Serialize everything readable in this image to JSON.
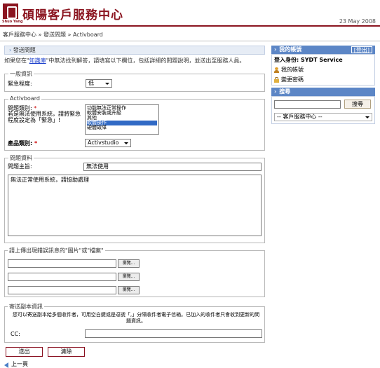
{
  "header": {
    "site_title": "碩陽客戶服務中心",
    "logo_text": "Shuo Yang",
    "date": "23 May 2008"
  },
  "breadcrumb": "客戶服務中心 » 發送問題 » Activboard",
  "form": {
    "section_title": "發送問題",
    "intro_before": "如果您在\"",
    "intro_link": "知識庫",
    "intro_after": "\"中無法找到解答，請填寫以下欄位，包括詳細的問題說明，並送出至服務人員。",
    "general": {
      "legend": "一般資訊",
      "priority_label": "緊急程度:",
      "priority_value": "低"
    },
    "activboard": {
      "legend": "Activboard",
      "problem_type_label": "問題類別:",
      "problem_type_note": "若是無法使用系統，請將緊急程度設定為「緊急」!",
      "problem_type_options": [
        "功能無法正常操作",
        "軟體安裝或升級",
        "其他",
        "軟體操作",
        "硬體故障"
      ],
      "problem_type_selected": "軟體操作",
      "product_label": "產品類別:",
      "product_value": "Activstudio"
    },
    "problem": {
      "legend": "問題資料",
      "subject_label": "問題主旨:",
      "subject_value": "無法使用",
      "description_value": "無法正常使用系統，請協助處理"
    },
    "attachments": {
      "legend": "請上傳出現錯誤訊息的\"圖片\"或\"檔案\"",
      "browse_label": "瀏覽..."
    },
    "cc": {
      "legend": "寄送副本資訊",
      "note": "您可以寄送副本給多個收件者，可用空白鍵或是逗號「,」分隔收件者電子信箱。已加入的收件者只會收到更新的問題資訊。",
      "cc_label": "CC:",
      "cc_value": ""
    },
    "submit_label": "送出",
    "clear_label": "清除",
    "back_label": "上一頁"
  },
  "sidebar": {
    "account": {
      "title": "我的帳號",
      "logout_label": "[登出]",
      "login_as": "登入身份: SYDT Service",
      "my_account": "我的帳號",
      "change_password": "變更密碼"
    },
    "search": {
      "title": "搜尋",
      "button_label": "搜尋",
      "input_value": "",
      "scope_value": "-- 客戶服務中心 --"
    }
  },
  "colors": {
    "brand": "#8b1520",
    "panel_header": "#5c86c6",
    "selection": "#316ac5"
  }
}
